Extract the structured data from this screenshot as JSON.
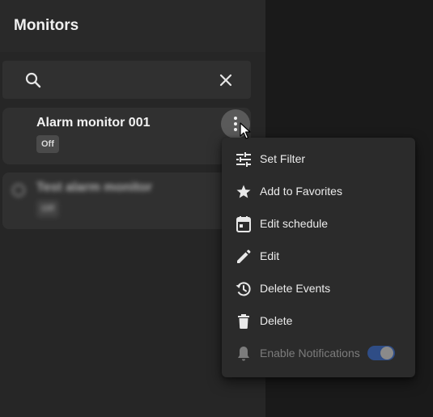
{
  "header": {
    "title": "Monitors"
  },
  "search": {
    "value": "",
    "placeholder": ""
  },
  "monitors": [
    {
      "name": "Alarm monitor 001",
      "status": "Off"
    },
    {
      "name": "Test alarm monitor",
      "status": "Off"
    }
  ],
  "context_menu": {
    "items": [
      {
        "label": "Set Filter",
        "icon": "tune-icon"
      },
      {
        "label": "Add to Favorites",
        "icon": "star-icon"
      },
      {
        "label": "Edit schedule",
        "icon": "calendar-icon"
      },
      {
        "label": "Edit",
        "icon": "pencil-icon"
      },
      {
        "label": "Delete Events",
        "icon": "history-icon"
      },
      {
        "label": "Delete",
        "icon": "trash-icon"
      },
      {
        "label": "Enable Notifications",
        "icon": "bell-icon",
        "disabled": true,
        "toggle": true
      }
    ]
  },
  "colors": {
    "panel": "#262626",
    "card": "#303030",
    "menu": "#2b2b2b",
    "toggle_track": "#2f4d86"
  }
}
